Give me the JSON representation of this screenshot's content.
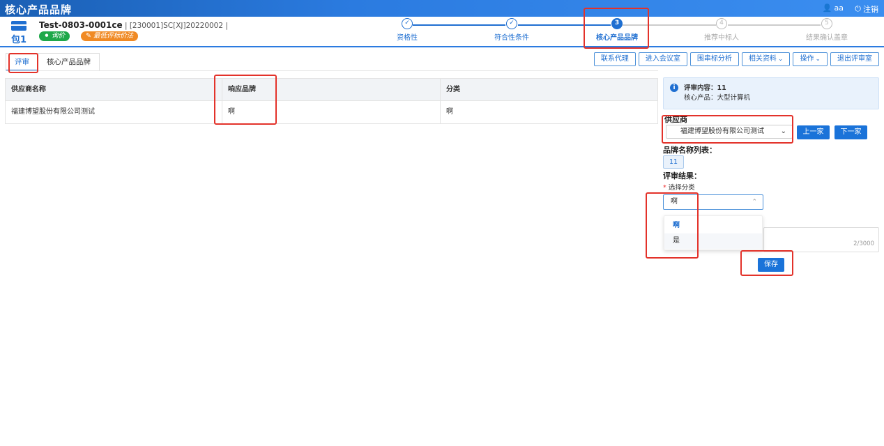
{
  "app": {
    "title": "核心产品品牌",
    "user": "aa",
    "logout": "注销"
  },
  "header": {
    "package_label": "包1",
    "project_code": "Test-0803-0001ce",
    "project_sub": " | [230001]SC[XJ]20220002 |",
    "tags": [
      {
        "label": "询价",
        "color": "#1fa84a"
      },
      {
        "label": "最低评标价法",
        "color": "#f08a24"
      }
    ]
  },
  "steps": [
    {
      "label": "资格性",
      "state": "done",
      "mark": "✓"
    },
    {
      "label": "符合性条件",
      "state": "done",
      "mark": "✓"
    },
    {
      "label": "核心产品品牌",
      "state": "active",
      "mark": "3"
    },
    {
      "label": "推荐中标人",
      "state": "todo",
      "mark": "4"
    },
    {
      "label": "结果确认盖章",
      "state": "todo",
      "mark": "5"
    }
  ],
  "tabs": [
    {
      "label": "评审",
      "active": true
    },
    {
      "label": "核心产品品牌",
      "active": false
    }
  ],
  "toolbar": [
    {
      "label": "联系代理"
    },
    {
      "label": "进入会议室"
    },
    {
      "label": "围串标分析"
    },
    {
      "label": "相关资料",
      "dropdown": true
    },
    {
      "label": "操作",
      "dropdown": true
    },
    {
      "label": "退出评审室"
    }
  ],
  "table": {
    "headers": [
      "供应商名称",
      "响应品牌",
      "分类"
    ],
    "rows": [
      [
        "福建博望股份有限公司测试",
        "啊",
        "啊"
      ]
    ]
  },
  "panel": {
    "info_content_label": "评审内容：",
    "info_content_value": "11",
    "info_product_label": "核心产品：",
    "info_product_value": "大型计算机",
    "supplier_label": "供应商",
    "supplier_value": "福建博望股份有限公司测试",
    "prev_label": "上一家",
    "next_label": "下一家",
    "brand_list_label": "品牌名称列表：",
    "brand_chip": "11",
    "result_label": "评审结果：",
    "select_cat_label": "选择分类",
    "category_value": "啊",
    "dropdown_options": [
      "啊",
      "是"
    ],
    "textarea_count": "2/3000",
    "save_label": "保存"
  },
  "colors": {
    "primary": "#1a73d9",
    "highlight": "#e3322a",
    "accent_green": "#1fa84a",
    "accent_orange": "#f08a24"
  }
}
